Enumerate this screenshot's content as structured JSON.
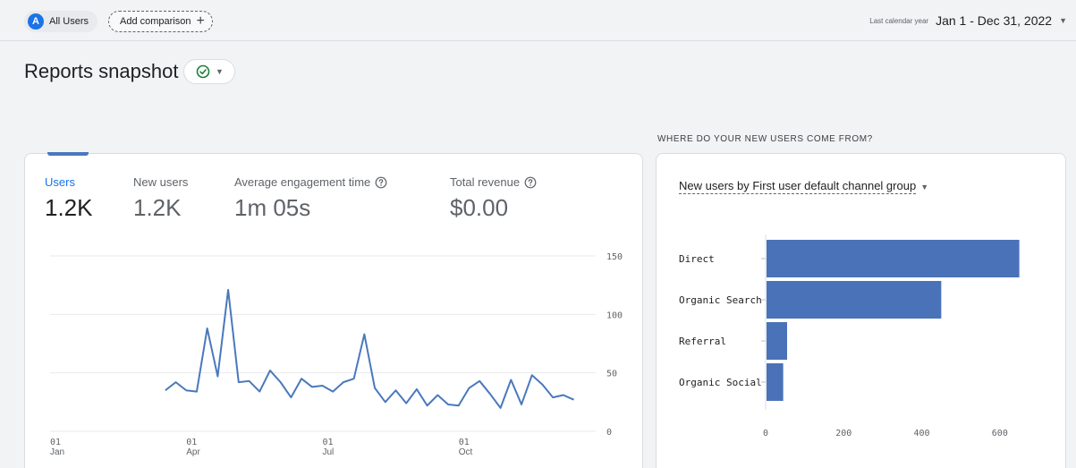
{
  "topbar": {
    "segment": {
      "avatar": "A",
      "label": "All Users"
    },
    "add_comparison": "Add comparison",
    "date_label": "Last calendar year",
    "date_value": "Jan 1 - Dec 31, 2022"
  },
  "page": {
    "title": "Reports snapshot"
  },
  "metrics": [
    {
      "label": "Users",
      "value": "1.2K"
    },
    {
      "label": "New users",
      "value": "1.2K"
    },
    {
      "label": "Average engagement time",
      "value": "1m 05s"
    },
    {
      "label": "Total revenue",
      "value": "$0.00"
    }
  ],
  "right_card": {
    "heading": "WHERE DO YOUR NEW USERS COME FROM?",
    "dimension_label": "New users by First user default channel group"
  },
  "colors": {
    "accent": "#1a73e8",
    "series": "#4a78bd",
    "bar": "#4a72b8",
    "grid": "#e8eaed"
  },
  "icons": {
    "status": "check-circle-icon",
    "help": "help-circle-icon",
    "add": "plus-icon",
    "dropdown": "caret-down-icon"
  },
  "chart_data": [
    {
      "type": "line",
      "x_tick_labels": [
        {
          "day": "01",
          "month": "Jan"
        },
        {
          "day": "01",
          "month": "Apr"
        },
        {
          "day": "01",
          "month": "Jul"
        },
        {
          "day": "01",
          "month": "Oct"
        }
      ],
      "y_tick_labels": [
        "0",
        "50",
        "100",
        "150"
      ],
      "ylim": [
        0,
        150
      ],
      "xlim_weeks": [
        0,
        52
      ],
      "grid": true,
      "series": [
        {
          "start_week": 11,
          "values": [
            35,
            42,
            35,
            34,
            88,
            47,
            121,
            42,
            43,
            34,
            52,
            42,
            29,
            45,
            38,
            39,
            34,
            42,
            45,
            83,
            37,
            25,
            35,
            24,
            36,
            22,
            31,
            23,
            22,
            37,
            43,
            32,
            20,
            44,
            23,
            48,
            40,
            29,
            31,
            27
          ]
        }
      ]
    },
    {
      "type": "bar",
      "orientation": "horizontal",
      "categories": [
        "Direct",
        "Organic Search",
        "Referral",
        "Organic Social"
      ],
      "values": [
        650,
        450,
        55,
        45
      ],
      "x_tick_labels": [
        "0",
        "200",
        "400",
        "600"
      ],
      "xlim": [
        0,
        660
      ]
    }
  ]
}
